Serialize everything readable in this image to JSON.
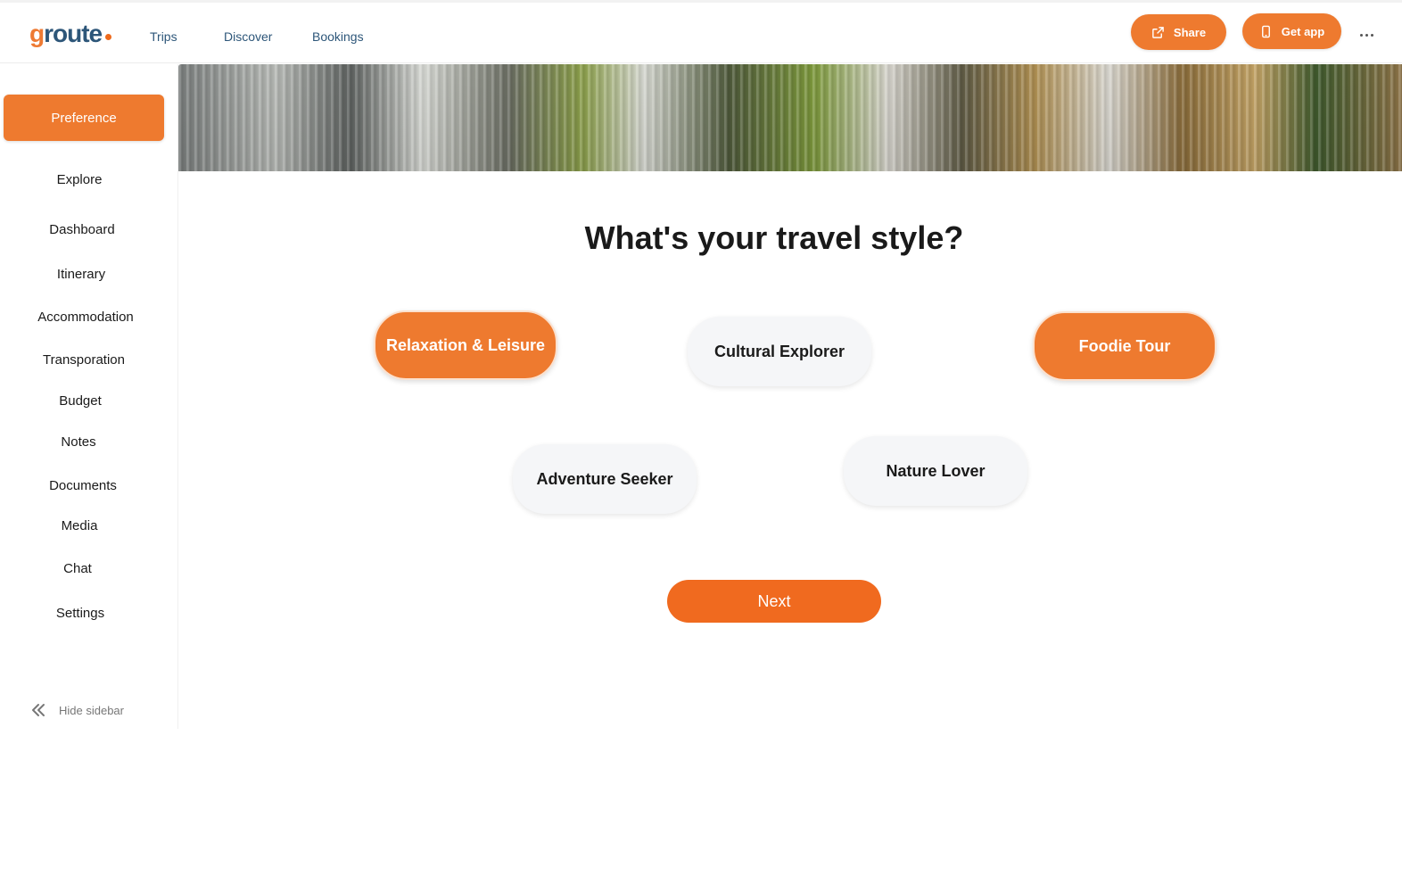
{
  "app": {
    "logo_g": "g",
    "logo_rest": "route",
    "brand_color": "#ee7a2f"
  },
  "header": {
    "nav": [
      "Trips",
      "Discover",
      "Bookings"
    ],
    "share_label": "Share",
    "share_icon": "share-icon",
    "getapp_label": "Get app",
    "getapp_icon": "phone-icon",
    "more_icon": "more-horizontal-icon"
  },
  "sidebar": {
    "active": "Preference",
    "items": [
      "Explore",
      "Dashboard",
      "Itinerary",
      "Accommodation",
      "Transporation",
      "Budget",
      "Notes",
      "Documents",
      "Media",
      "Chat",
      "Settings"
    ],
    "hide_label": "Hide sidebar",
    "hide_icon": "double-chevron-left-icon"
  },
  "main": {
    "question": "What's your travel style?",
    "options": [
      {
        "label": "Relaxation & Leisure",
        "selected": true
      },
      {
        "label": "Cultural Explorer",
        "selected": false
      },
      {
        "label": "Foodie Tour",
        "selected": true
      },
      {
        "label": "Adventure Seeker",
        "selected": false
      },
      {
        "label": "Nature Lover",
        "selected": false
      }
    ],
    "next_label": "Next"
  }
}
